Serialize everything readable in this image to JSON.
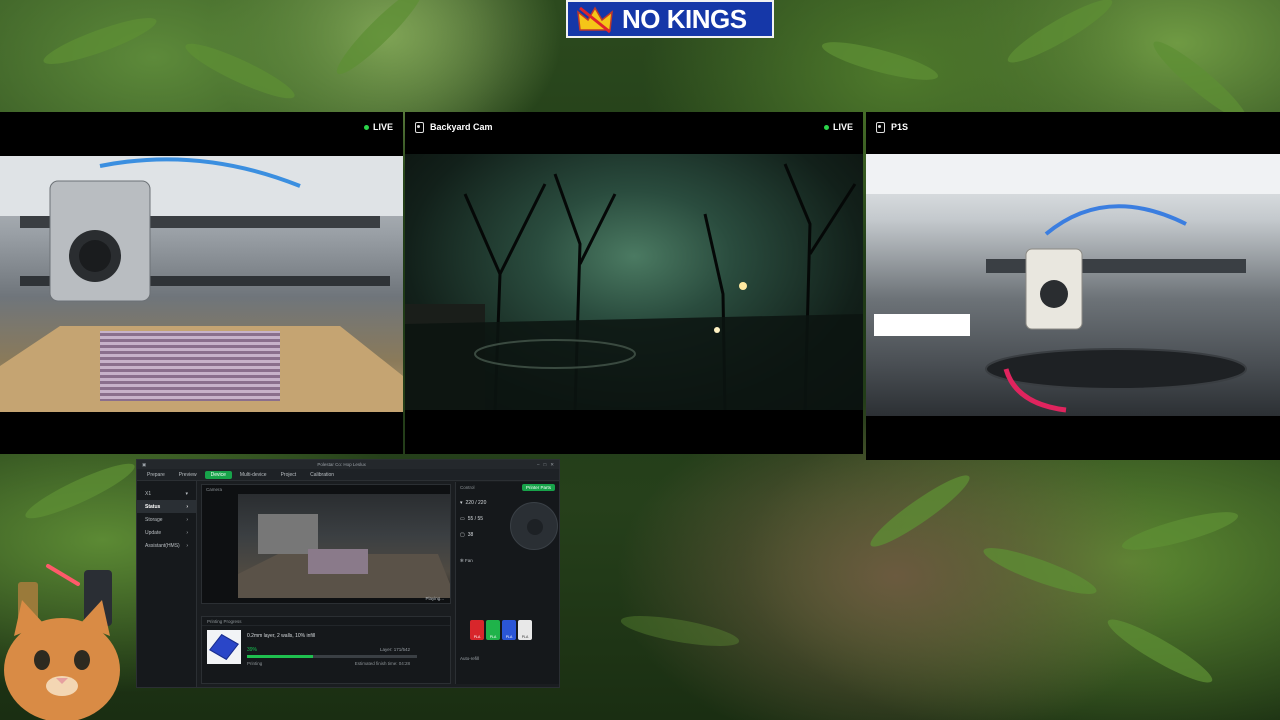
{
  "logo": {
    "text": "NO KINGS"
  },
  "cameras": [
    {
      "title": "",
      "live": "LIVE"
    },
    {
      "title": "Backyard Cam",
      "live": "LIVE"
    },
    {
      "title": "P1S",
      "live": ""
    }
  ],
  "app": {
    "window_title": "Polestar Co: Hop Leslux",
    "menu": [
      "Prepare",
      "Preview",
      "Device",
      "Multi-device",
      "Project",
      "Calibration"
    ],
    "active_menu": "Device",
    "device": "X1",
    "sidebar": [
      "Status",
      "Storage",
      "Update",
      "Assistant(HMS)"
    ],
    "camera_bar": "Camera",
    "playing": "Playing...",
    "progress_header": "Printing Progress",
    "job_name": "0.2mm layer, 2 walls, 10% infill",
    "percent": "39%",
    "progress_fraction": 0.39,
    "layer": "Layer: 171/542",
    "status": "Printing",
    "eta": "Estimated finish time: 04:28",
    "control_header": "Control",
    "parts_button": "Printer Parts",
    "temps": [
      "220 / 220",
      "55 / 55",
      "38"
    ],
    "fan_label": "Fan",
    "ams_spools": [
      {
        "label": "PLA",
        "color": "#d8262b"
      },
      {
        "label": "PLA",
        "color": "#1fb34a"
      },
      {
        "label": "PLA",
        "color": "#2b56d6"
      },
      {
        "label": "PLA",
        "color": "#e8e8e8"
      }
    ],
    "auto_refill": "Auto-refill"
  }
}
